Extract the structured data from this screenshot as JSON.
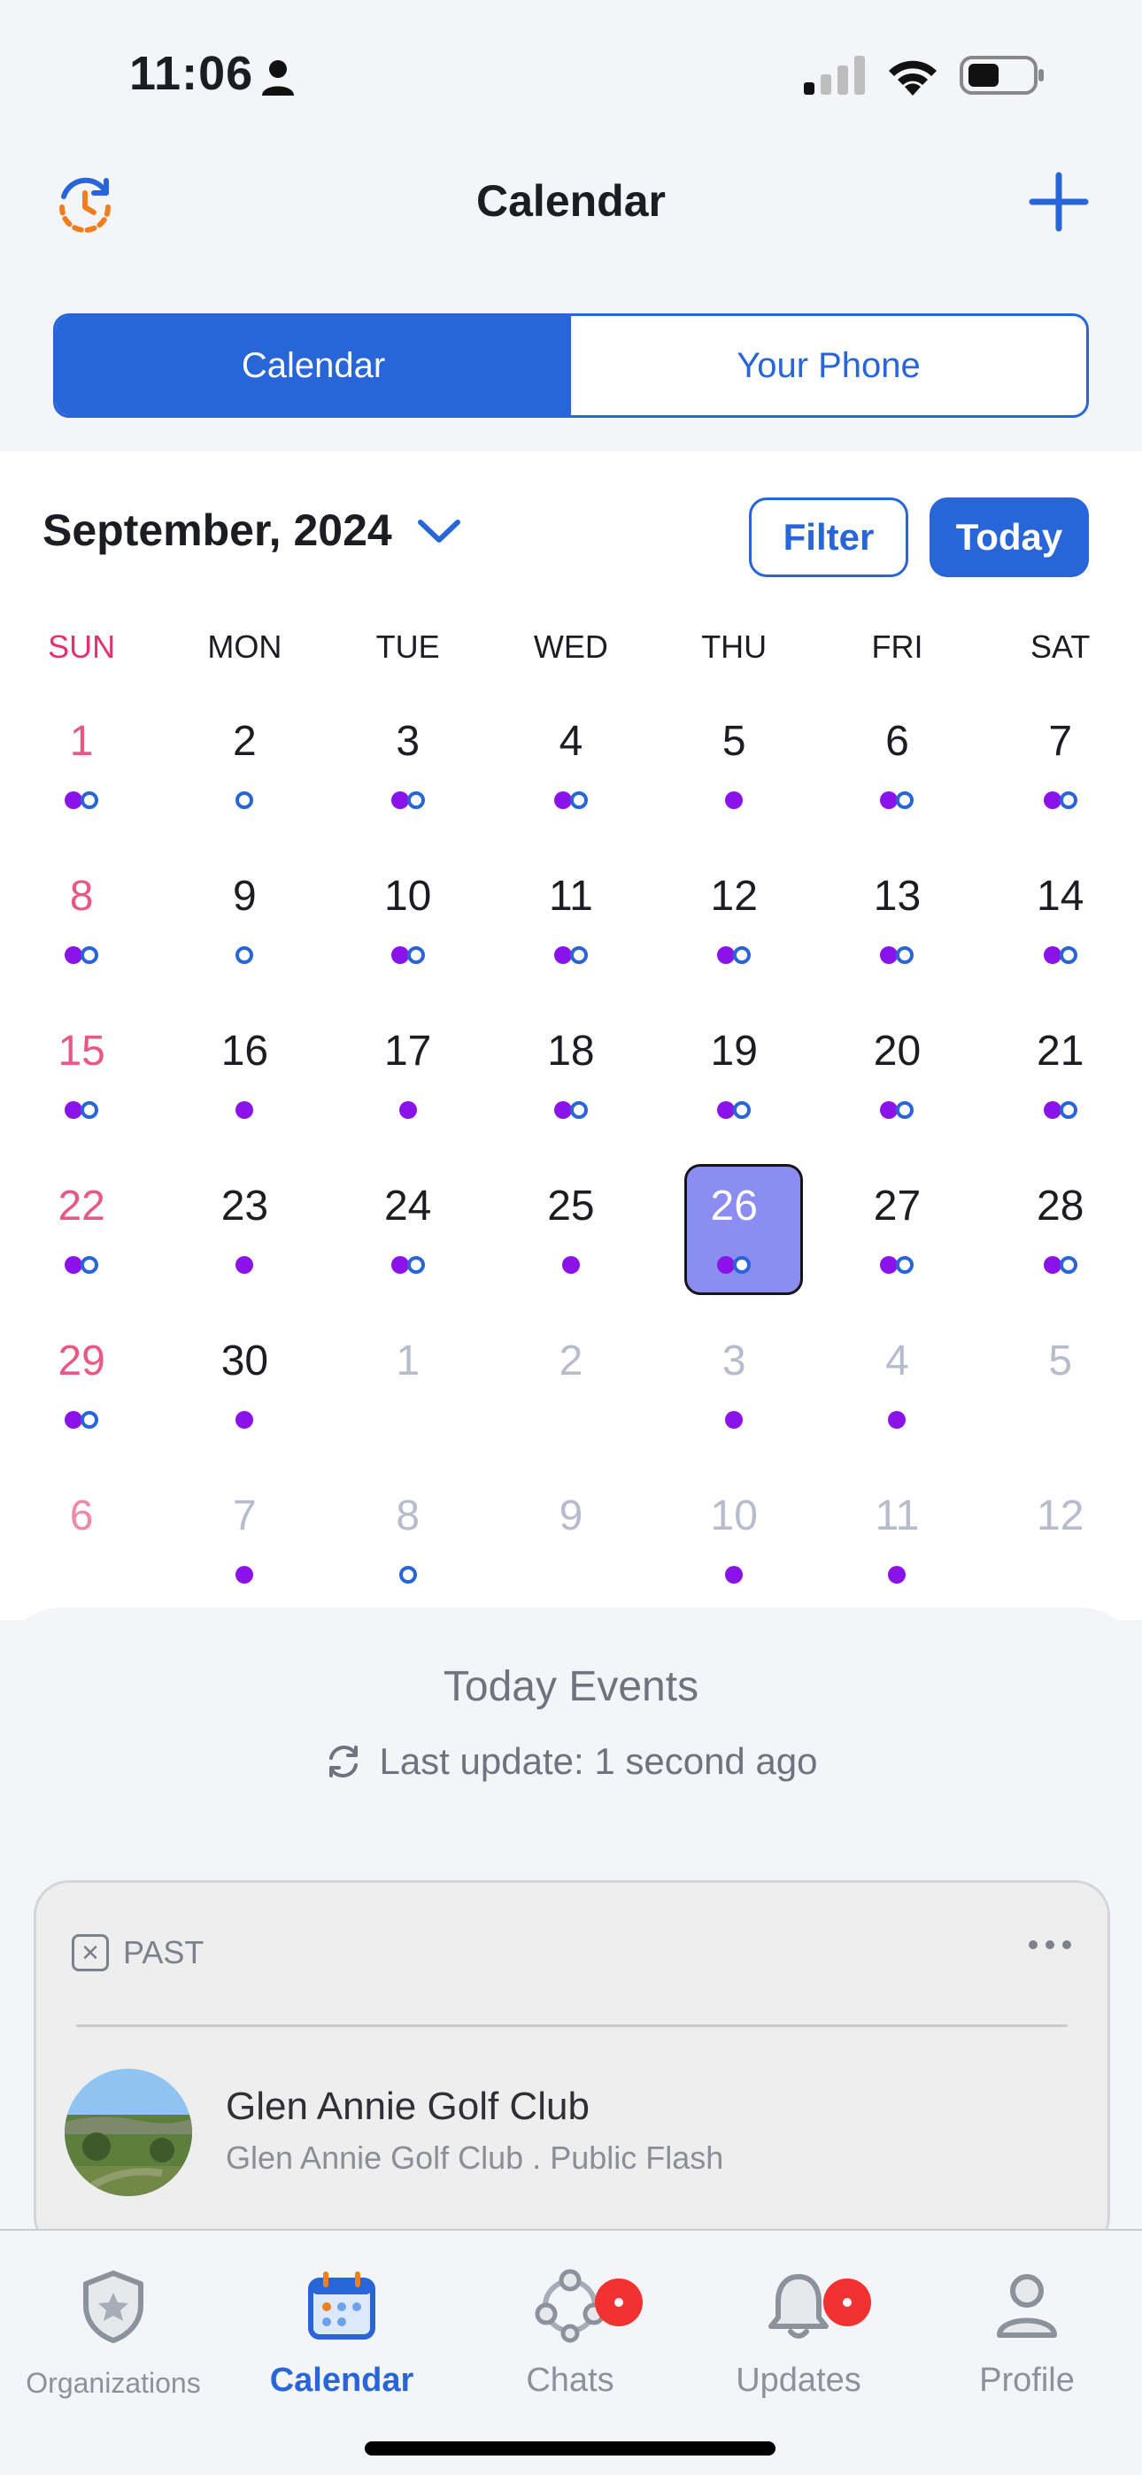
{
  "status_bar": {
    "time": "11:06"
  },
  "header": {
    "title": "Calendar",
    "history_icon": "history-clock-icon",
    "add_icon": "plus-icon"
  },
  "segmented": {
    "calendar_label": "Calendar",
    "phone_label": "Your Phone"
  },
  "calendar": {
    "month_label": "September, 2024",
    "filter_label": "Filter",
    "today_label": "Today",
    "weekdays": [
      "SUN",
      "MON",
      "TUE",
      "WED",
      "THU",
      "FRI",
      "SAT"
    ],
    "selected_day": "26",
    "weeks": [
      [
        {
          "n": "1",
          "d": "fr"
        },
        {
          "n": "2",
          "d": "r"
        },
        {
          "n": "3",
          "d": "fr"
        },
        {
          "n": "4",
          "d": "fr"
        },
        {
          "n": "5",
          "d": "f"
        },
        {
          "n": "6",
          "d": "fr"
        },
        {
          "n": "7",
          "d": "fr"
        }
      ],
      [
        {
          "n": "8",
          "d": "fr"
        },
        {
          "n": "9",
          "d": "r"
        },
        {
          "n": "10",
          "d": "fr"
        },
        {
          "n": "11",
          "d": "fr"
        },
        {
          "n": "12",
          "d": "fr"
        },
        {
          "n": "13",
          "d": "fr"
        },
        {
          "n": "14",
          "d": "fr"
        }
      ],
      [
        {
          "n": "15",
          "d": "fr"
        },
        {
          "n": "16",
          "d": "f"
        },
        {
          "n": "17",
          "d": "f"
        },
        {
          "n": "18",
          "d": "fr"
        },
        {
          "n": "19",
          "d": "fr"
        },
        {
          "n": "20",
          "d": "fr"
        },
        {
          "n": "21",
          "d": "fr"
        }
      ],
      [
        {
          "n": "22",
          "d": "fr"
        },
        {
          "n": "23",
          "d": "f"
        },
        {
          "n": "24",
          "d": "fr"
        },
        {
          "n": "25",
          "d": "f"
        },
        {
          "n": "26",
          "d": "fr",
          "sel": true
        },
        {
          "n": "27",
          "d": "fr"
        },
        {
          "n": "28",
          "d": "fr"
        }
      ],
      [
        {
          "n": "29",
          "d": "fr"
        },
        {
          "n": "30",
          "d": "f"
        },
        {
          "n": "1",
          "d": "",
          "o": true
        },
        {
          "n": "2",
          "d": "",
          "o": true
        },
        {
          "n": "3",
          "d": "f",
          "o": true
        },
        {
          "n": "4",
          "d": "f",
          "o": true
        },
        {
          "n": "5",
          "d": "",
          "o": true
        }
      ],
      [
        {
          "n": "6",
          "d": "",
          "o": true
        },
        {
          "n": "7",
          "d": "f",
          "o": true
        },
        {
          "n": "8",
          "d": "r",
          "o": true
        },
        {
          "n": "9",
          "d": "",
          "o": true
        },
        {
          "n": "10",
          "d": "f",
          "o": true
        },
        {
          "n": "11",
          "d": "f",
          "o": true
        },
        {
          "n": "12",
          "d": "",
          "o": true
        }
      ]
    ]
  },
  "events": {
    "title": "Today Events",
    "last_update": "Last update: 1 second ago",
    "card": {
      "status": "PAST",
      "name": "Glen Annie Golf Club",
      "subtitle": "Glen Annie Golf Club . Public Flash"
    }
  },
  "tabs": [
    {
      "label": "Organizations",
      "icon": "shield-star-icon"
    },
    {
      "label": "Calendar",
      "icon": "calendar-icon"
    },
    {
      "label": "Chats",
      "icon": "chat-network-icon"
    },
    {
      "label": "Updates",
      "icon": "bell-icon"
    },
    {
      "label": "Profile",
      "icon": "person-icon"
    }
  ],
  "colors": {
    "accent": "#2765D9",
    "event_dot": "#8B12E8",
    "selected_day": "#8C8DF2",
    "sunday": "#E5316C",
    "badge": "#F23131"
  }
}
